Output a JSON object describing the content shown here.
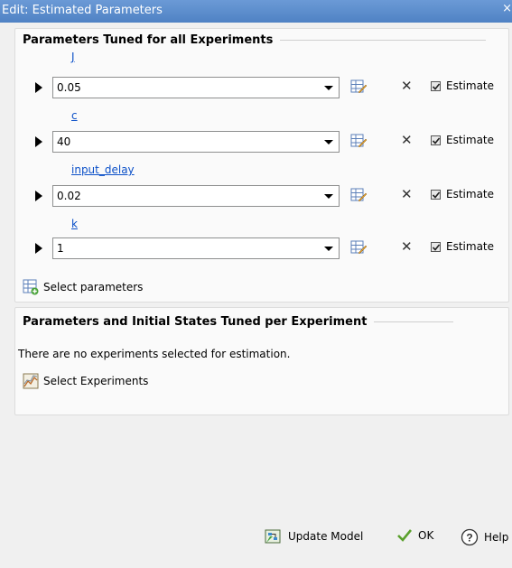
{
  "window": {
    "title": "Edit: Estimated Parameters",
    "close_glyph": "×"
  },
  "section_global": {
    "title": "Parameters Tuned for all Experiments"
  },
  "parameters": [
    {
      "name": "J",
      "value": "0.05",
      "estimate_label": "Estimate",
      "estimate_checked": true
    },
    {
      "name": "c",
      "value": "40",
      "estimate_label": "Estimate",
      "estimate_checked": true
    },
    {
      "name": "input_delay",
      "value": "0.02",
      "estimate_label": "Estimate",
      "estimate_checked": true
    },
    {
      "name": "k",
      "value": "1",
      "estimate_label": "Estimate",
      "estimate_checked": true
    }
  ],
  "select_parameters": {
    "label": "Select parameters"
  },
  "section_per_experiment": {
    "title": "Parameters and Initial States Tuned per Experiment",
    "message": "There are no experiments selected for estimation.",
    "select_experiments_label": "Select Experiments"
  },
  "footer": {
    "update_model_label": "Update Model",
    "ok_label": "OK",
    "help_label": "Help"
  },
  "colors": {
    "title_bar": "#4f82c4",
    "link_blue": "#0b50c8",
    "ok_check_green": "#5aa02c"
  },
  "icons": {
    "edit": "pencil-table-icon",
    "delete": "x-delete-icon",
    "select_parameters": "table-add-icon",
    "select_experiments": "experiment-chart-icon",
    "update_model": "update-model-icon",
    "ok": "checkmark-icon",
    "help": "question-circle-icon"
  }
}
